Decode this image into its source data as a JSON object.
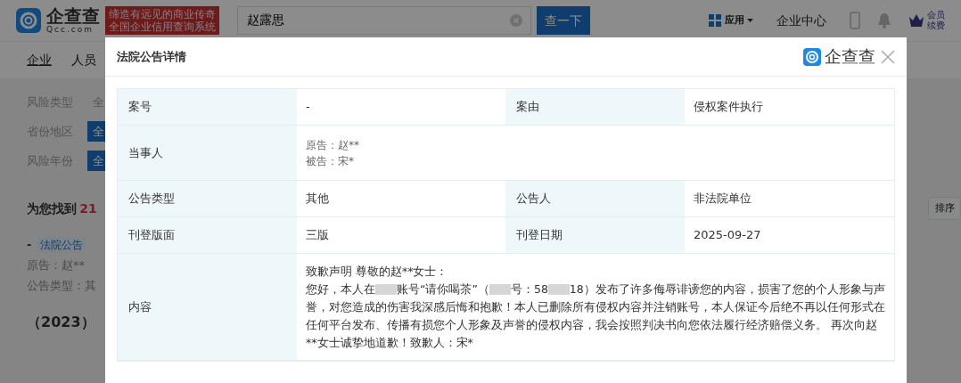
{
  "header": {
    "logo_text": "企查查",
    "logo_sub": "Qcc.com",
    "slogan": [
      "缔造有远见的商业传奇",
      "全国企业信用查询系统"
    ],
    "search": {
      "value": "赵露思"
    },
    "search_button": "查一下",
    "apps_menu": "应用",
    "enterprise_center": "企业中心",
    "member": [
      "会员",
      "续费"
    ]
  },
  "nav": [
    {
      "label": "企业",
      "selected": true
    },
    {
      "label": "人员",
      "selected": false
    }
  ],
  "filters": [
    {
      "label": "风险类型",
      "value": "全",
      "selected": false
    },
    {
      "label": "省份地区",
      "value": "全",
      "selected": true
    },
    {
      "label": "风险年份",
      "value": "全",
      "selected": true
    }
  ],
  "results": {
    "prefix": "为您找到",
    "count": "21",
    "sort_button": "排序",
    "item": {
      "dash": "-",
      "tag": "法院公告",
      "lines": [
        "原告：赵**",
        "公告类型：其"
      ]
    },
    "next_title": "（2023）"
  },
  "modal": {
    "title": "法院公告详情",
    "brand": "企查查",
    "rows": [
      {
        "kind": "pair",
        "cells": [
          {
            "label": "案号",
            "value": "-"
          },
          {
            "label": "案由",
            "value": "侵权案件执行"
          }
        ]
      },
      {
        "kind": "lines",
        "label": "当事人",
        "lines": [
          "原告：赵**",
          "被告：宋*"
        ]
      },
      {
        "kind": "pair",
        "cells": [
          {
            "label": "公告类型",
            "value": "其他"
          },
          {
            "label": "公告人",
            "value": "非法院单位"
          }
        ]
      },
      {
        "kind": "pair",
        "cells": [
          {
            "label": "刊登版面",
            "value": "三版"
          },
          {
            "label": "刊登日期",
            "value": "2025-09-27"
          }
        ]
      },
      {
        "kind": "content",
        "label": "内容",
        "heading": "致歉声明 尊敬的赵**女士：",
        "segments": [
          {
            "kind": "text",
            "text": "您好，本人在"
          },
          {
            "kind": "redacted"
          },
          {
            "kind": "text",
            "text": "账号“请你喝茶”（"
          },
          {
            "kind": "redacted"
          },
          {
            "kind": "text",
            "text": "号：58"
          },
          {
            "kind": "redacted"
          },
          {
            "kind": "text",
            "text": "18）发布了许多侮辱诽谤您的内容，损害了您的个人形象与声誉，对您造成的伤害我深感后悔和抱歉！本人已删除所有侵权内容并注销账号，本人保证今后绝不再以任何形式在任何平台发布、传播有损您个人形象及声誉的侵权内容，我会按照判决书向您依法履行经济赔偿义务。 再次向赵**女士诚挚地道歉！致歉人：宋*"
          }
        ]
      }
    ]
  }
}
